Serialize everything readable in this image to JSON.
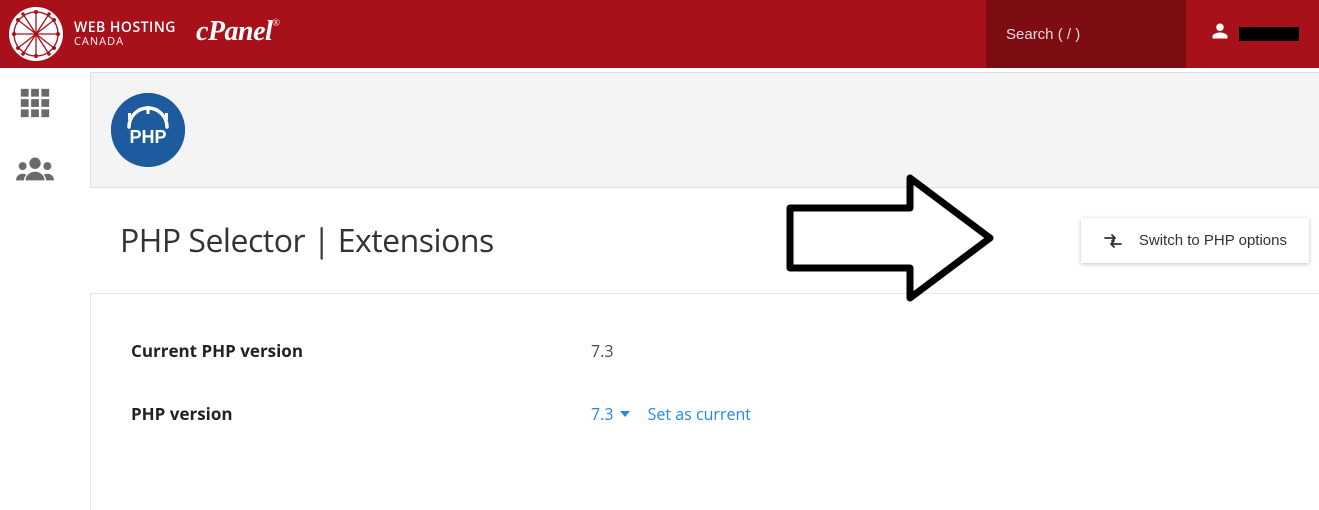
{
  "header": {
    "brand_line1": "WEB HOSTING",
    "brand_line2": "CANADA",
    "cpanel_label": "cPanel",
    "search_placeholder": "Search ( / )"
  },
  "sidebar": {
    "grid_icon": "grid-icon",
    "users_icon": "users-icon"
  },
  "tool": {
    "badge_text": "PHP",
    "page_title": "PHP Selector | Extensions",
    "switch_button": "Switch to PHP options"
  },
  "info": {
    "current_label": "Current PHP version",
    "current_value": "7.3",
    "version_label": "PHP version",
    "version_selected": "7.3",
    "set_current_label": "Set as current"
  }
}
